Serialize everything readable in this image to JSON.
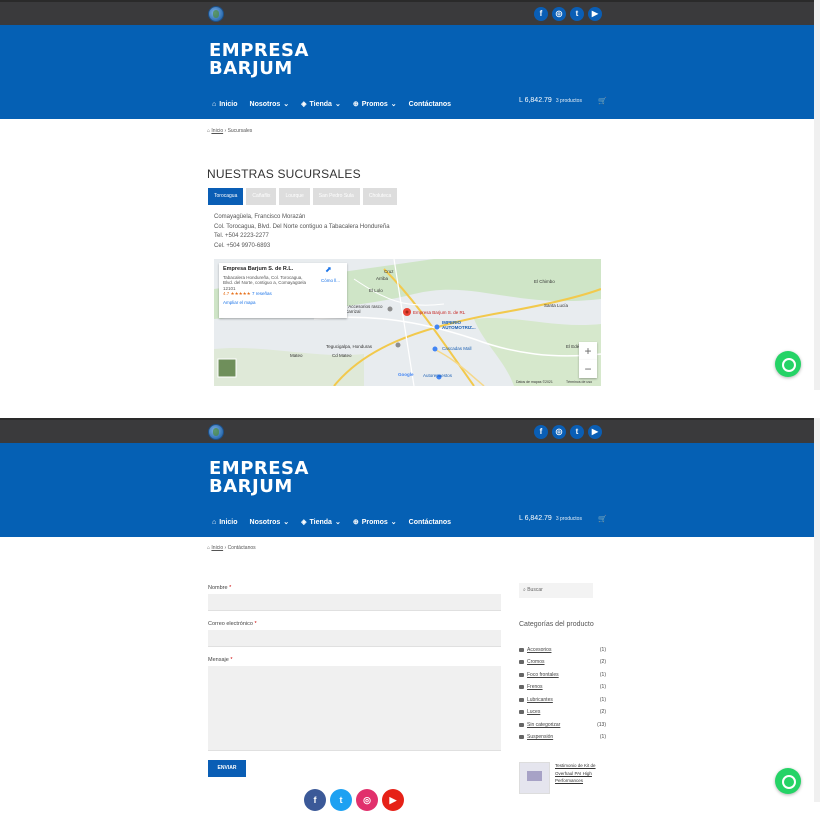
{
  "site": {
    "logo_line1": "EMPRESA",
    "logo_line2": "BARJUM",
    "brand_color": "#0560b4",
    "social_icons": [
      "facebook-icon",
      "instagram-icon",
      "twitter-icon",
      "youtube-icon"
    ]
  },
  "nav": {
    "items": [
      {
        "label": "Inicio",
        "icon": "home-icon"
      },
      {
        "label": "Nosotros",
        "icon": "chevron-down-icon"
      },
      {
        "label": "Tienda",
        "icon": "chevron-down-icon"
      },
      {
        "label": "Promos",
        "icon": "chevron-down-icon"
      },
      {
        "label": "Contáctanos"
      }
    ],
    "cart_total": "L 6,842.79",
    "cart_count": "3 productos"
  },
  "page1": {
    "breadcrumb_home": "Inicio",
    "breadcrumb_current": "Sucursales",
    "title": "NUESTRAS SUCURSALES",
    "tabs": [
      "Torocagua",
      "Cañaflix",
      "Lourque",
      "San Pedro Sula",
      "Choluteca"
    ],
    "address_lines": [
      "Comayagüela, Francisco Morazán",
      "Col. Torocagua, Blvd. Del Norte contiguo a Tabacalera Hondureña",
      "Tel. +504 2223-2277",
      "Cel. +504 9970-6893"
    ],
    "map": {
      "place_name": "Empresa Barjum S. de R.L.",
      "place_address": "Tabacalera Hondureña, Col. Torocagua, Blvd. del Norte, contiguo a, Comayagüela 12101",
      "rating": "4.7",
      "stars": "★★★★★",
      "reviews": "7 reseñas",
      "enlarge": "Ampliar el mapa",
      "directions": "Cómo ll...",
      "pin_label": "Empresa Barjum S. de RL",
      "labels": [
        "El Chimbo",
        "Santa Lucía",
        "El Edén",
        "IMPERIO AUTOMOTRIZ...",
        "Cascadas Mall",
        "Autorepuestos",
        "Tegucigalpa, Honduras",
        "Mateo",
        "Cd Mateo",
        "El Lolo",
        "y Accesorios rasco Carrizal",
        "Arriba",
        "Cruz"
      ],
      "attribution": "Datos de mapas ©2021",
      "terms": "Términos de uso",
      "google": "Google",
      "zoom_in": "+",
      "zoom_out": "−"
    }
  },
  "page2": {
    "breadcrumb_home": "Inicio",
    "breadcrumb_current": "Contáctanos",
    "form": {
      "name_label": "Nombre",
      "email_label": "Correo electrónico",
      "message_label": "Mensaje",
      "required_mark": "*",
      "submit_label": "ENVIAR"
    },
    "sidebar": {
      "search_placeholder": "Buscar",
      "categories_title": "Categorías del producto",
      "categories": [
        {
          "name": "Accesorios",
          "count": "(1)"
        },
        {
          "name": "Cromos",
          "count": "(2)"
        },
        {
          "name": "Foco frontales",
          "count": "(1)"
        },
        {
          "name": "Frenos",
          "count": "(1)"
        },
        {
          "name": "Lubricantes",
          "count": "(1)"
        },
        {
          "name": "Luces",
          "count": "(2)"
        },
        {
          "name": "Sin categorizar",
          "count": "(13)"
        },
        {
          "name": "Suspensión",
          "count": "(1)"
        }
      ],
      "product_title": "Testimonio de Kit de Overhaul PAI High Performances"
    }
  }
}
